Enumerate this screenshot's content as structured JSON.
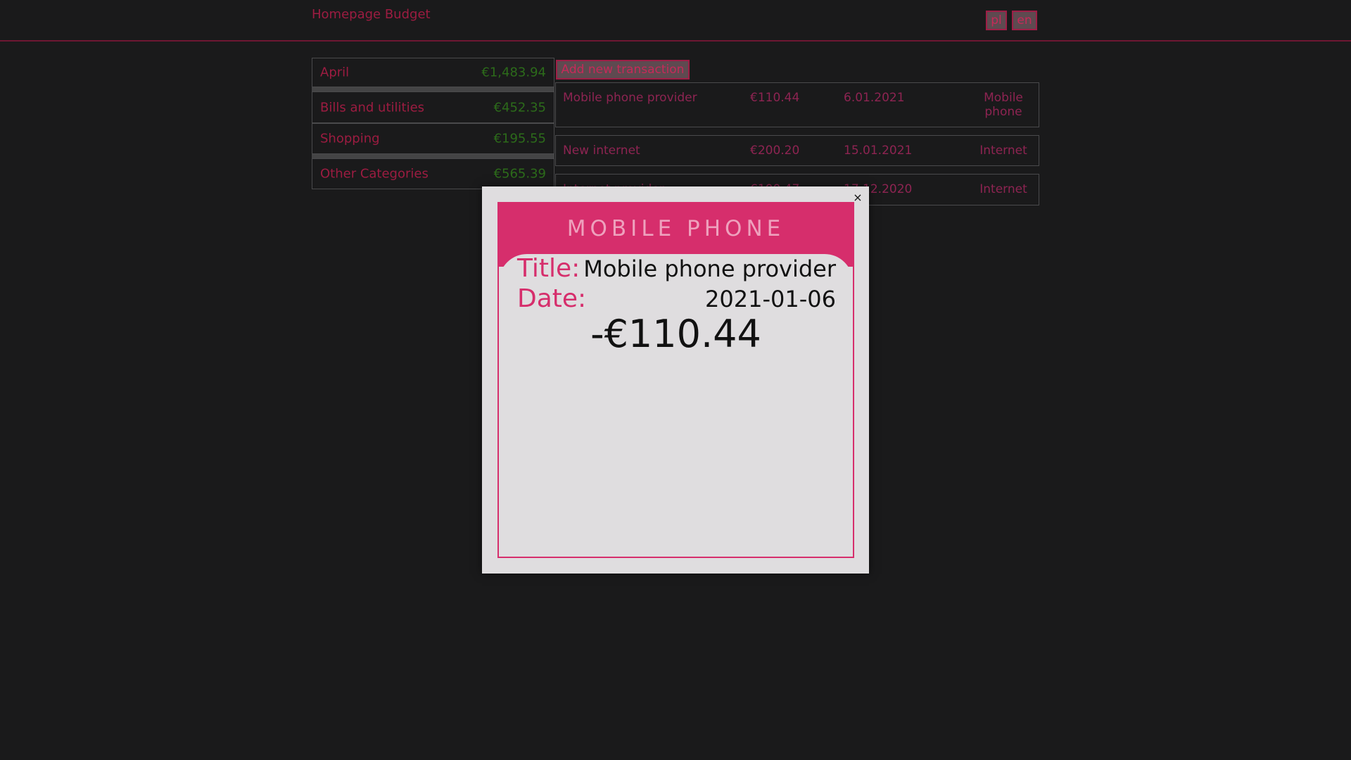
{
  "header": {
    "app_title": "Homepage Budget",
    "languages": [
      "pl",
      "en"
    ]
  },
  "categories": [
    {
      "name": "April",
      "amount": "€1,483.94"
    },
    {
      "name": "Bills and utilities",
      "amount": "€452.35"
    },
    {
      "name": "Shopping",
      "amount": "€195.55"
    },
    {
      "name": "Other Categories",
      "amount": "€565.39"
    }
  ],
  "actions": {
    "add_transaction_label": "Add new transaction"
  },
  "transactions": [
    {
      "title": "Mobile phone provider",
      "amount": "€110.44",
      "date": "6.01.2021",
      "category": "Mobile phone"
    },
    {
      "title": "New internet",
      "amount": "€200.20",
      "date": "15.01.2021",
      "category": "Internet"
    },
    {
      "title": "Internet provider",
      "amount": "€100.47",
      "date": "17.12.2020",
      "category": "Internet"
    }
  ],
  "modal": {
    "close_glyph": "×",
    "heading": "MOBILE PHONE",
    "title_label": "Title:",
    "title_value": "Mobile phone provider",
    "date_label": "Date:",
    "date_value": "2021-01-06",
    "amount": "-€110.44"
  },
  "colors": {
    "accent": "#d62e6c",
    "income_green": "#2c6b1a",
    "background": "#1a1a1b"
  }
}
